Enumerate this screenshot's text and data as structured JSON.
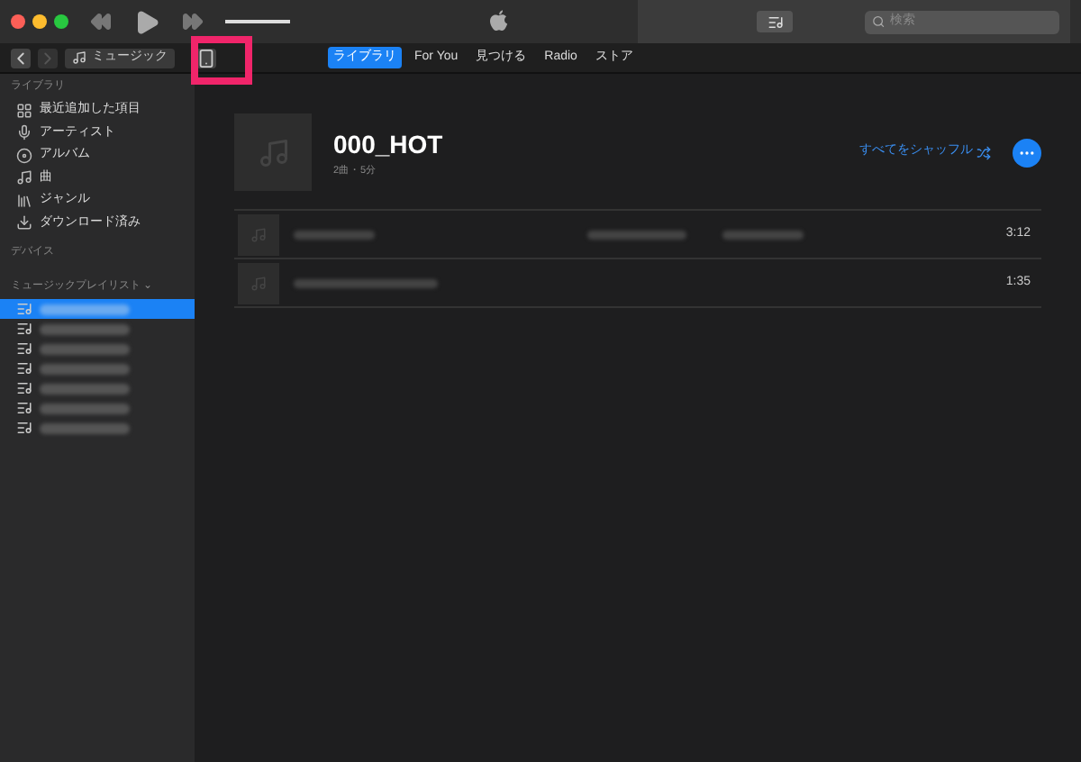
{
  "toolbar": {
    "search": {
      "placeholder": "検索"
    },
    "volume": {
      "level": 1
    }
  },
  "navbar": {
    "media_picker": "ミュージック",
    "tabs": [
      {
        "label": "ライブラリ",
        "selected": true
      },
      {
        "label": "For You",
        "selected": false
      },
      {
        "label": "見つける",
        "selected": false
      },
      {
        "label": "Radio",
        "selected": false
      },
      {
        "label": "ストア",
        "selected": false
      }
    ]
  },
  "sidebar": {
    "library_heading": "ライブラリ",
    "library_items": [
      {
        "kind": "recent",
        "label": "最近追加した項目"
      },
      {
        "kind": "artist",
        "label": "アーティスト"
      },
      {
        "kind": "album",
        "label": "アルバム"
      },
      {
        "kind": "song",
        "label": "曲"
      },
      {
        "kind": "genre",
        "label": "ジャンル"
      },
      {
        "kind": "download",
        "label": "ダウンロード済み"
      }
    ],
    "devices_heading": "デバイス",
    "playlists_heading": "ミュージックプレイリスト ⌄",
    "playlists": [
      {
        "selected": true
      },
      {
        "selected": false
      },
      {
        "selected": false
      },
      {
        "selected": false
      },
      {
        "selected": false
      },
      {
        "selected": false
      },
      {
        "selected": false
      }
    ]
  },
  "playlist": {
    "title": "000_HOT",
    "subtitle": "2曲・5分",
    "shuffle": "すべてをシャッフル",
    "songs": [
      {
        "time": "3:12"
      },
      {
        "time": "1:35"
      }
    ]
  }
}
